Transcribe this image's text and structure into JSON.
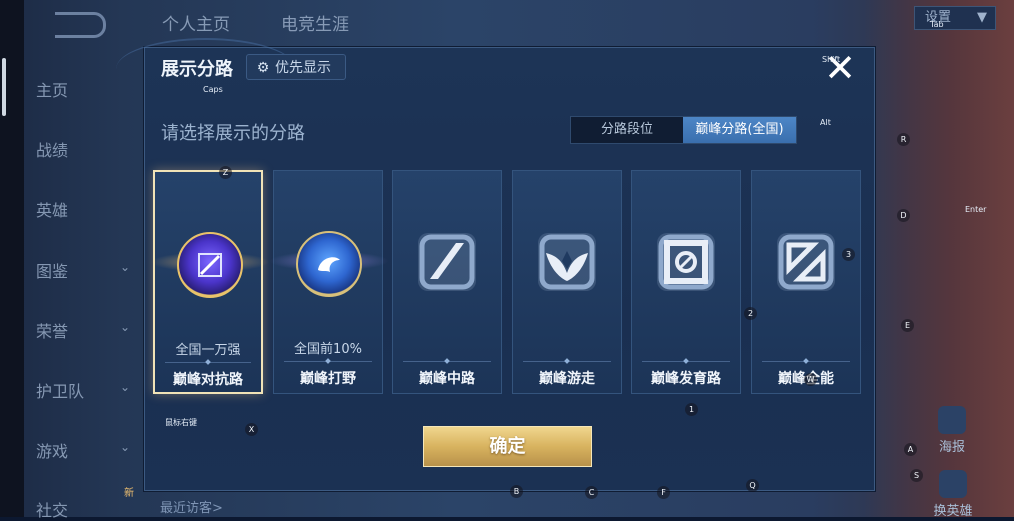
{
  "background": {
    "top_nav": [
      "个人主页",
      "电竞生涯"
    ],
    "side_nav": [
      {
        "label": "主页",
        "has_chevron": false
      },
      {
        "label": "战绩",
        "has_chevron": false
      },
      {
        "label": "英雄",
        "has_chevron": false
      },
      {
        "label": "图鉴",
        "has_chevron": true
      },
      {
        "label": "荣誉",
        "has_chevron": true
      },
      {
        "label": "护卫队",
        "has_chevron": true
      },
      {
        "label": "游戏",
        "has_chevron": true
      },
      {
        "label": "社交",
        "has_chevron": false
      }
    ],
    "settings_label": "设置",
    "right_buttons": [
      "海报",
      "换英雄"
    ],
    "bottom_text": "最近访客>",
    "new_badge": "新"
  },
  "modal": {
    "title": "展示分路",
    "priority_label": "优先显示",
    "close_label": "✕",
    "subtitle": "请选择展示的分路",
    "segment": {
      "options": [
        "分路段位",
        "巅峰分路(全国)"
      ],
      "selected_index": 1
    },
    "cards": [
      {
        "label": "巅峰对抗路",
        "rank": "全国一万强",
        "icon": "topbrawler-medal-icon",
        "selected": true
      },
      {
        "label": "巅峰打野",
        "rank": "全国前10%",
        "icon": "jungle-medal-icon",
        "selected": false
      },
      {
        "label": "巅峰中路",
        "rank": "",
        "icon": "midlane-icon",
        "selected": false
      },
      {
        "label": "巅峰游走",
        "rank": "",
        "icon": "roamer-icon",
        "selected": false
      },
      {
        "label": "巅峰发育路",
        "rank": "",
        "icon": "farmlane-icon",
        "selected": false
      },
      {
        "label": "巅峰全能",
        "rank": "",
        "icon": "allround-icon",
        "selected": false
      }
    ],
    "confirm_label": "确定"
  },
  "key_hints": {
    "caps": "Caps",
    "shift": "Shift",
    "tab": "Tab",
    "alt": "Alt",
    "enter": "Enter",
    "z": "Z",
    "x": "X",
    "r": "R",
    "d": "D",
    "e": "E",
    "a": "A",
    "s": "S",
    "b": "B",
    "c": "C",
    "f": "F",
    "q": "Q",
    "w": "W",
    "n1": "1",
    "n2": "2",
    "n3": "3",
    "mouse_right": "鼠标右键"
  },
  "colors": {
    "modal_bg": "#1d3456",
    "accent_blue": "#4d86c6",
    "confirm_gold": "#d8b35f",
    "selected_border": "#f1e3b7"
  }
}
